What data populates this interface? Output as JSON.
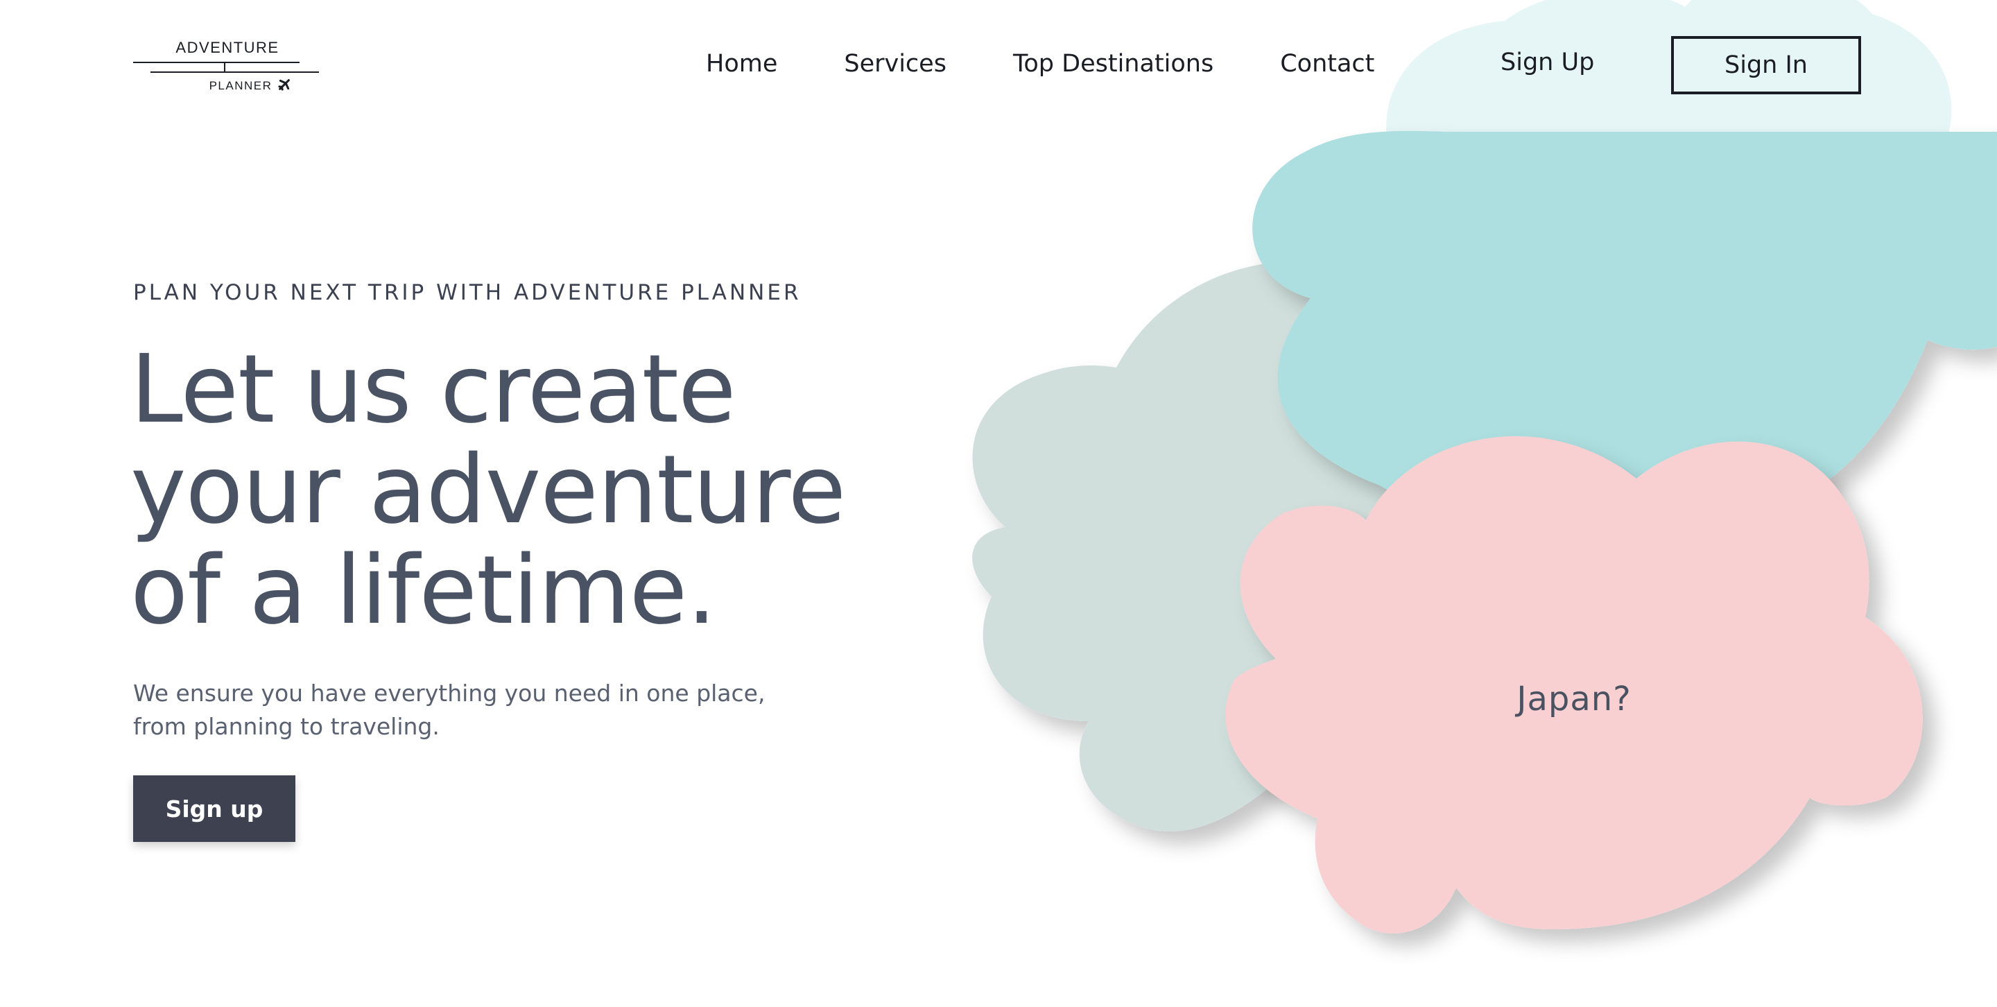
{
  "header": {
    "logo": {
      "top_text": "ADVENTURE",
      "bottom_text": "PLANNER"
    },
    "nav": [
      {
        "label": "Home"
      },
      {
        "label": "Services"
      },
      {
        "label": "Top Destinations"
      },
      {
        "label": "Contact"
      }
    ],
    "sign_up_label": "Sign Up",
    "sign_in_label": "Sign In"
  },
  "hero": {
    "eyebrow": "PLAN YOUR NEXT TRIP WITH ADVENTURE PLANNER",
    "headline_lines": [
      "Let us create",
      "your adventure",
      "of a lifetime."
    ],
    "subtext_lines": [
      "We ensure you have everything you need in one place,",
      "from planning to traveling."
    ],
    "cta_label": "Sign up"
  },
  "clouds": {
    "label": "Japan?",
    "colors": {
      "pale_teal": "#e6f6f6",
      "teal": "#addfe0",
      "sage": "#d0dfdc",
      "pink": "#f9d0d2"
    }
  },
  "icons": {
    "logo_plane": "plane-icon"
  }
}
